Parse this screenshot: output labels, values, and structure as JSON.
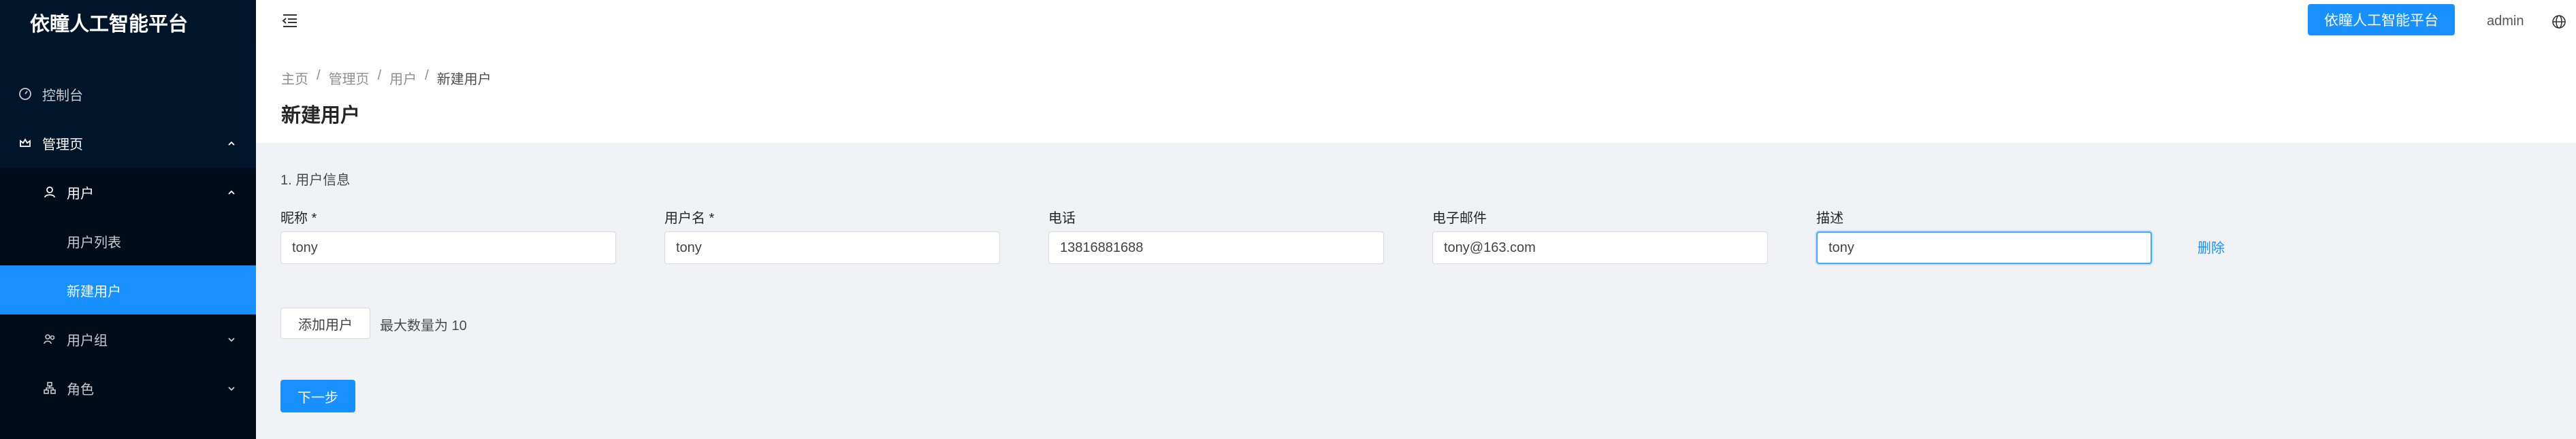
{
  "app": {
    "title": "依瞳人工智能平台"
  },
  "sidebar": {
    "items": [
      {
        "label": "控制台",
        "icon": "dashboard-icon"
      },
      {
        "label": "管理页",
        "icon": "crown-icon",
        "expanded": true
      },
      {
        "label": "用户",
        "icon": "user-icon",
        "expanded": true
      },
      {
        "label": "用户列表"
      },
      {
        "label": "新建用户",
        "active": true
      },
      {
        "label": "用户组",
        "icon": "team-icon",
        "expanded": false
      },
      {
        "label": "角色",
        "icon": "cluster-icon",
        "expanded": false
      }
    ]
  },
  "header": {
    "menu_fold_icon": "menu-fold-icon",
    "platform_button": "依瞳人工智能平台",
    "username": "admin",
    "language_icon": "global-icon"
  },
  "breadcrumb": [
    "主页",
    "管理页",
    "用户",
    "新建用户"
  ],
  "page": {
    "title": "新建用户"
  },
  "form": {
    "section_title": "1. 用户信息",
    "fields": [
      {
        "label": "昵称 *",
        "value": "tony"
      },
      {
        "label": "用户名 *",
        "value": "tony"
      },
      {
        "label": "电话",
        "value": "13816881688"
      },
      {
        "label": "电子邮件",
        "value": "tony@163.com"
      },
      {
        "label": "描述",
        "value": "tony"
      }
    ],
    "delete_label": "删除",
    "add_button": "添加用户",
    "max_note": "最大数量为 10",
    "next_button": "下一步"
  },
  "colors": {
    "primary": "#1890ff",
    "sidebar_bg": "#001529",
    "submenu_bg": "#000c17"
  }
}
